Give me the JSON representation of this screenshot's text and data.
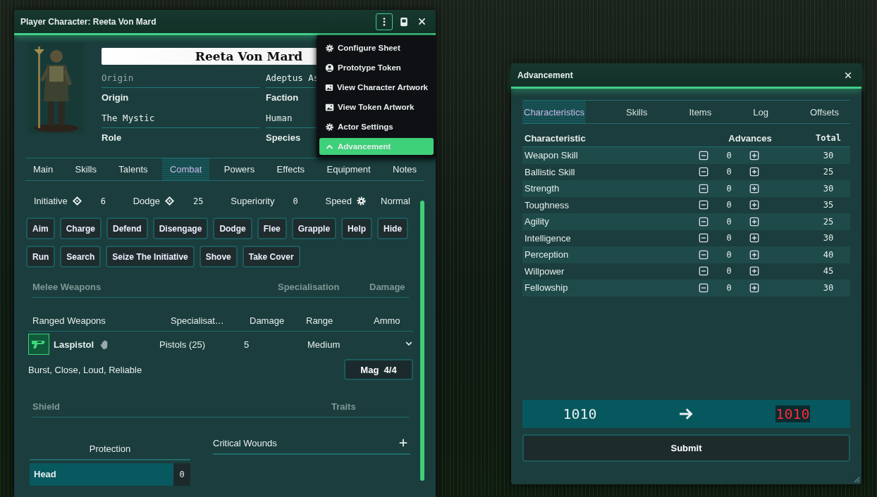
{
  "sheet": {
    "title": "Player Character: Reeta Von Mard",
    "name": "Reeta Von Mard",
    "fields": [
      {
        "placeholder": "Origin",
        "label": "Origin"
      },
      {
        "value": "Adeptus As",
        "label": "Faction"
      },
      {
        "value": "The Mystic",
        "label": "Role"
      },
      {
        "value": "Human",
        "label": "Species"
      }
    ],
    "menu": [
      {
        "label": "Configure Sheet",
        "selected": false
      },
      {
        "label": "Prototype Token",
        "selected": false
      },
      {
        "label": "View Character Artwork",
        "selected": false
      },
      {
        "label": "View Token Artwork",
        "selected": false
      },
      {
        "label": "Actor Settings",
        "selected": false
      },
      {
        "label": "Advancement",
        "selected": true
      }
    ],
    "tabs": [
      {
        "label": "Main",
        "selected": false
      },
      {
        "label": "Skills",
        "selected": false
      },
      {
        "label": "Talents",
        "selected": false
      },
      {
        "label": "Combat",
        "selected": true
      },
      {
        "label": "Powers",
        "selected": false
      },
      {
        "label": "Effects",
        "selected": false
      },
      {
        "label": "Equipment",
        "selected": false
      },
      {
        "label": "Notes",
        "selected": false
      }
    ],
    "stats": [
      {
        "label": "Initiative",
        "value": "6"
      },
      {
        "label": "Dodge",
        "value": "25"
      },
      {
        "label": "Superiority",
        "value": "0"
      },
      {
        "label": "Speed",
        "value": "Normal"
      }
    ],
    "actions": [
      "Aim",
      "Charge",
      "Defend",
      "Disengage",
      "Dodge",
      "Flee",
      "Grapple",
      "Help",
      "Hide",
      "Run",
      "Search",
      "Seize The Initiative",
      "Shove",
      "Take Cover"
    ],
    "melee": {
      "title": "Melee Weapons",
      "columns": [
        "Specialisation",
        "Damage"
      ]
    },
    "ranged": {
      "title": "Ranged Weapons",
      "columns": [
        "Specialisat…",
        "Damage",
        "Range",
        "Ammo"
      ],
      "rows": [
        {
          "name": "Laspistol",
          "specialisation": "Pistols (25)",
          "damage": "5",
          "range": "Medium",
          "traits": "Burst, Close, Loud, Reliable",
          "ammo": "Mag  4/4"
        }
      ]
    },
    "shield": {
      "title": "Shield",
      "columns": [
        "Traits"
      ]
    },
    "protection": {
      "title": "Protection",
      "rows": [
        {
          "label": "Head",
          "value": "0"
        }
      ]
    },
    "critical_wounds": {
      "title": "Critical Wounds"
    }
  },
  "advancement": {
    "title": "Advancement",
    "tabs": [
      {
        "label": "Characteristics",
        "selected": true
      },
      {
        "label": "Skills",
        "selected": false
      },
      {
        "label": "Items",
        "selected": false
      },
      {
        "label": "Log",
        "selected": false
      },
      {
        "label": "Offsets",
        "selected": false
      }
    ],
    "columns": [
      "Characteristic",
      "Advances",
      "Total"
    ],
    "rows": [
      {
        "name": "Weapon Skill",
        "advances": "0",
        "total": "30"
      },
      {
        "name": "Ballistic Skill",
        "advances": "0",
        "total": "25"
      },
      {
        "name": "Strength",
        "advances": "0",
        "total": "30"
      },
      {
        "name": "Toughness",
        "advances": "0",
        "total": "35"
      },
      {
        "name": "Agility",
        "advances": "0",
        "total": "25"
      },
      {
        "name": "Intelligence",
        "advances": "0",
        "total": "30"
      },
      {
        "name": "Perception",
        "advances": "0",
        "total": "40"
      },
      {
        "name": "Willpower",
        "advances": "0",
        "total": "45"
      },
      {
        "name": "Fellowship",
        "advances": "0",
        "total": "30"
      }
    ],
    "xp": {
      "current": "1010",
      "after": "1010",
      "insufficient": true
    },
    "submit": "Submit"
  }
}
